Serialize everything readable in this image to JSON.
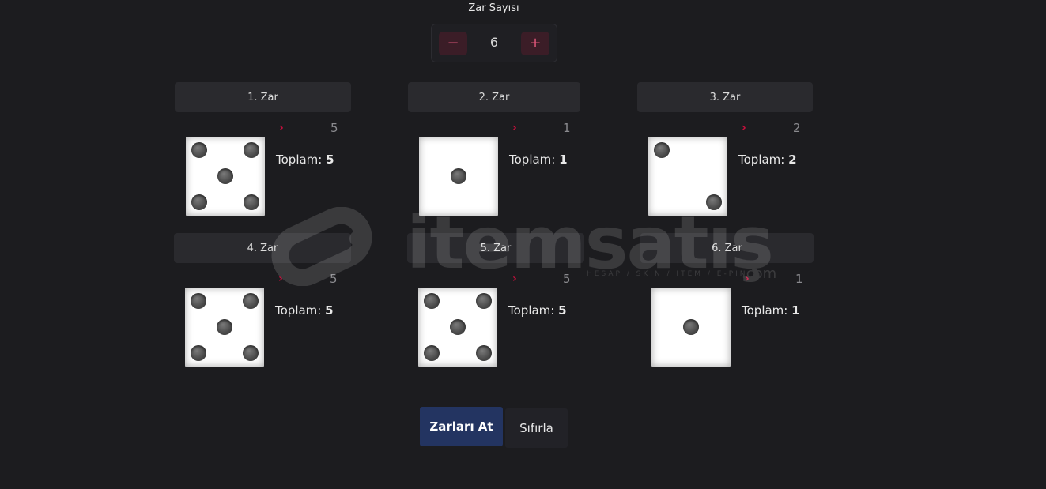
{
  "dice_count": {
    "label": "Zar Sayısı",
    "value": "6",
    "minus_label": "−",
    "plus_label": "+"
  },
  "dice": [
    {
      "header": "1. Zar",
      "roll": "5",
      "total_label": "Toplam:",
      "total": "5",
      "face": 5
    },
    {
      "header": "2. Zar",
      "roll": "1",
      "total_label": "Toplam:",
      "total": "1",
      "face": 1
    },
    {
      "header": "3. Zar",
      "roll": "2",
      "total_label": "Toplam:",
      "total": "2",
      "face": 2
    },
    {
      "header": "4. Zar",
      "roll": "5",
      "total_label": "Toplam:",
      "total": "5",
      "face": 5
    },
    {
      "header": "5. Zar",
      "roll": "5",
      "total_label": "Toplam:",
      "total": "5",
      "face": 5
    },
    {
      "header": "6. Zar",
      "roll": "1",
      "total_label": "Toplam:",
      "total": "1",
      "face": 1
    }
  ],
  "arrow_icon": "›",
  "watermark": {
    "brand": "itemsatış",
    "tagline": "HESAP / SKIN / ITEM / E-PIN",
    "domain": ".com"
  },
  "actions": {
    "roll_label": "Zarları At",
    "reset_label": "Sıfırla"
  },
  "colors": {
    "background": "#1c1c1f",
    "accent_red": "#c8103d",
    "primary_button": "#233461"
  }
}
